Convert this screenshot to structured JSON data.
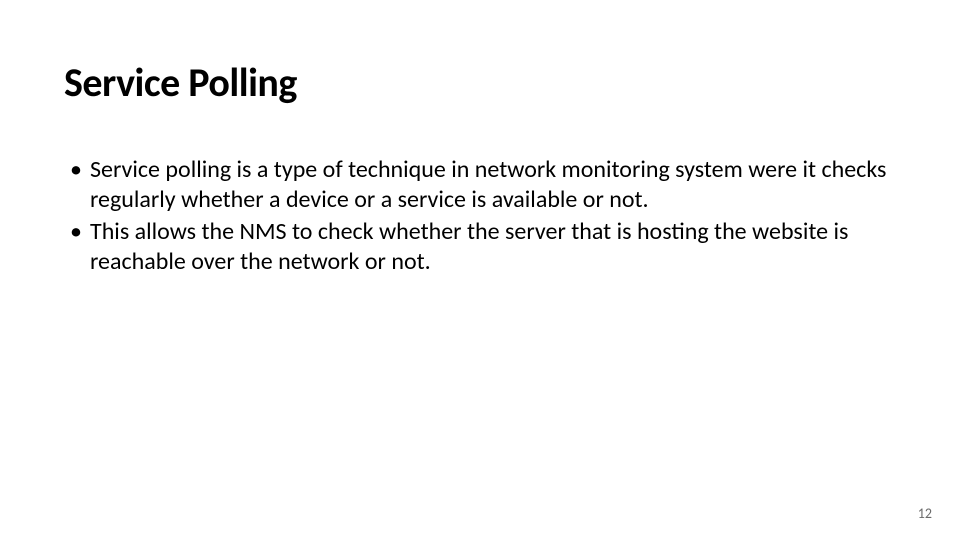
{
  "slide": {
    "title": "Service Polling",
    "bullets": [
      "Service polling is a type of technique in network monitoring system were it checks regularly whether a device or a service is available or not.",
      "This allows the NMS to check whether the server that is hosting the website is reachable over the network or not."
    ],
    "page_number": "12"
  }
}
